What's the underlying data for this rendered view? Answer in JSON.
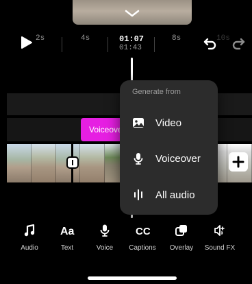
{
  "timeline": {
    "ticks": [
      "2s",
      "4s",
      "8s",
      "10s"
    ],
    "current_time": "01:07",
    "total_time": "01:43"
  },
  "track": {
    "voiceover_clip_label": "Voiceover"
  },
  "popover": {
    "title": "Generate from",
    "items": [
      {
        "label": "Video",
        "icon": "image-icon"
      },
      {
        "label": "Voiceover",
        "icon": "microphone-icon"
      },
      {
        "label": "All audio",
        "icon": "audio-bars-icon"
      }
    ]
  },
  "toolbar": {
    "items": [
      {
        "label": "Audio",
        "icon": "music-note-icon"
      },
      {
        "label": "Text",
        "icon": "text-aa-icon"
      },
      {
        "label": "Voice",
        "icon": "microphone-icon"
      },
      {
        "label": "Captions",
        "icon": "captions-cc-icon"
      },
      {
        "label": "Overlay",
        "icon": "overlay-icon"
      },
      {
        "label": "Sound FX",
        "icon": "sound-fx-icon"
      }
    ]
  },
  "colors": {
    "background": "#000000",
    "popover": "#2c2c2c",
    "voiceover_clip": "#e61fe2"
  }
}
